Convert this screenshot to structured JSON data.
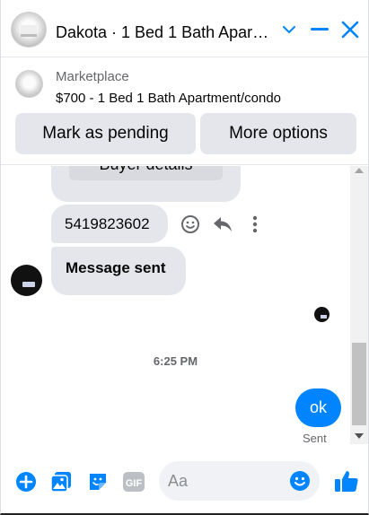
{
  "header": {
    "title": "Dakota · 1 Bed 1 Bath Apar…",
    "avatar_icon": "listing-photo-avatar",
    "icons": [
      "chevron-down-icon",
      "minimize-icon",
      "close-icon"
    ],
    "accent_color": "#0084ff"
  },
  "marketplace": {
    "label": "Marketplace",
    "item": "$700 - 1 Bed 1 Bath Apartment/condo",
    "buttons": {
      "mark_pending": "Mark as pending",
      "more_options": "More options"
    }
  },
  "thread": {
    "prev_bubble_button": "Buyer details",
    "phone_message": "5419823602",
    "message_actions": [
      "smile-icon",
      "reply-icon",
      "more-vertical-icon"
    ],
    "sent_notice": "Message sent",
    "timestamp": "6:25 PM",
    "outgoing_message": "ok",
    "delivery_status": "Sent"
  },
  "composer": {
    "placeholder": "Aa",
    "value": "",
    "icons": [
      "plus-circle-icon",
      "image-icon",
      "sticker-icon",
      "gif-icon",
      "emoji-icon",
      "thumbs-up-icon"
    ],
    "gif_label": "GIF"
  }
}
